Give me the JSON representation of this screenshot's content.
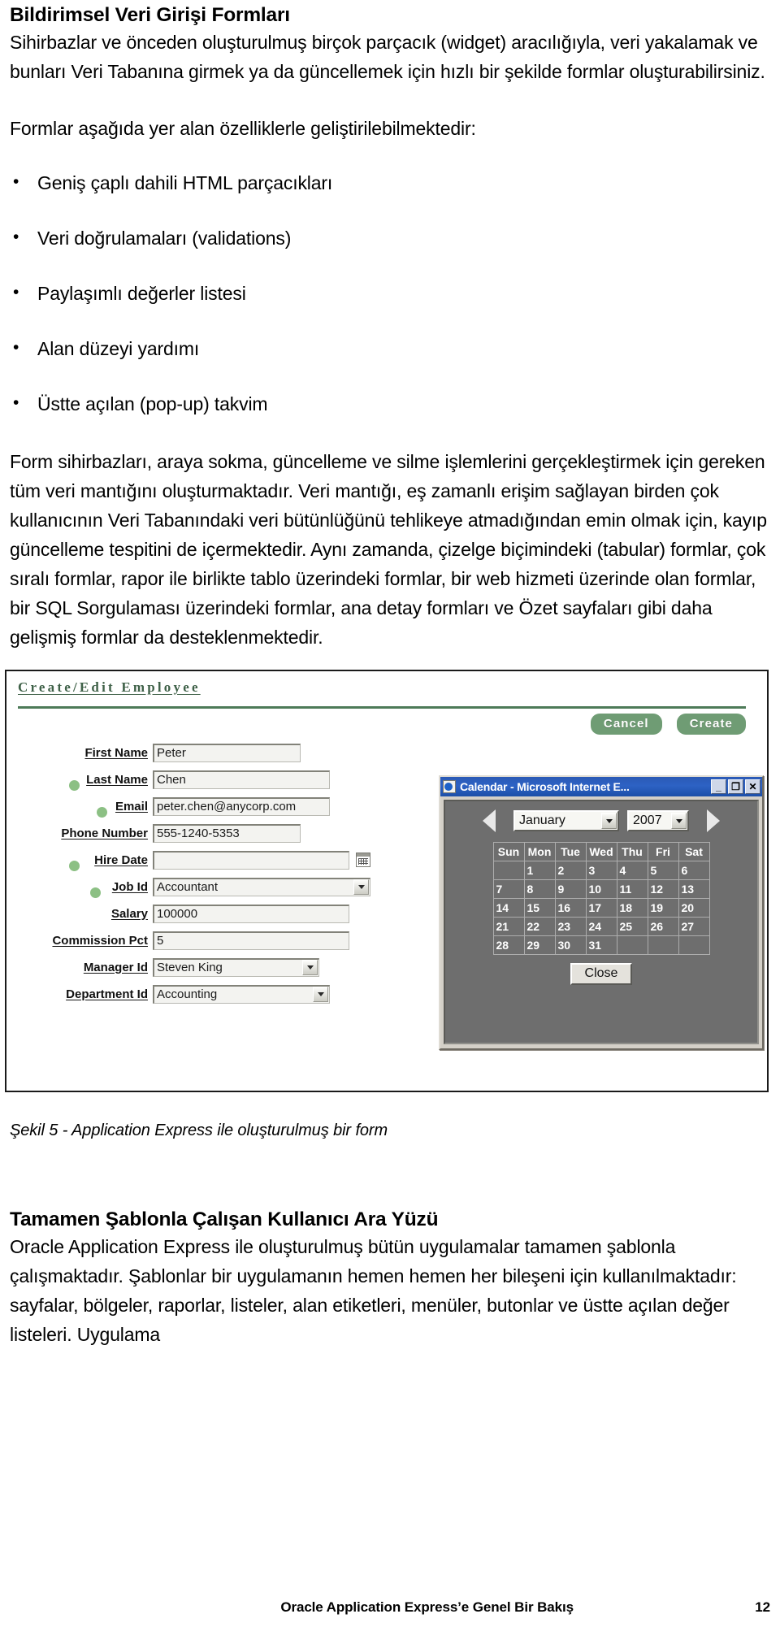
{
  "document": {
    "heading": "Bildirimsel Veri Girişi Formları",
    "intro_paragraph": "Sihirbazlar ve önceden oluşturulmuş birçok parçacık (widget) aracılığıyla, veri yakalamak ve bunları Veri Tabanına girmek ya da güncellemek için hızlı bir şekilde formlar oluşturabilirsiniz.",
    "lead_in": "Formlar aşağıda yer alan özelliklerle geliştirilebilmektedir:",
    "bullets": [
      "Geniş çaplı dahili HTML parçacıkları",
      "Veri doğrulamaları (validations)",
      " Paylaşımlı değerler listesi",
      "Alan düzeyi yardımı",
      "Üstte açılan (pop-up) takvim"
    ],
    "body_paragraph": "Form sihirbazları, araya sokma, güncelleme ve silme işlemlerini gerçekleştirmek için gereken tüm veri mantığını oluşturmaktadır.  Veri mantığı, eş zamanlı erişim sağlayan birden çok kullanıcının Veri Tabanındaki veri bütünlüğünü tehlikeye atmadığından emin olmak için, kayıp güncelleme tespitini de içermektedir.  Aynı zamanda, çizelge biçimindeki (tabular) formlar, çok sıralı formlar, rapor ile birlikte tablo üzerindeki formlar, bir web hizmeti üzerinde olan formlar, bir SQL Sorgulaması üzerindeki formlar, ana detay formları ve Özet sayfaları gibi daha gelişmiş formlar da desteklenmektedir.",
    "figure_caption": "Şekil 5 - Application Express ile oluşturulmuş bir form",
    "section2_heading": "Tamamen Şablonla Çalışan Kullanıcı Ara Yüzü",
    "section2_paragraph": "Oracle Application Express ile oluşturulmuş bütün uygulamalar tamamen şablonla çalışmaktadır.  Şablonlar bir uygulamanın hemen hemen her bileşeni için kullanılmaktadır:  sayfalar, bölgeler, raporlar, listeler, alan etiketleri, menüler, butonlar ve üstte açılan değer listeleri.  Uygulama"
  },
  "footer": {
    "title": "Oracle Application Express’e Genel Bir Bakış",
    "page_number": "12"
  },
  "figure": {
    "apex_form": {
      "region_title": "Create/Edit Employee",
      "buttons": [
        {
          "name": "cancel",
          "label": "Cancel"
        },
        {
          "name": "create",
          "label": "Create"
        }
      ],
      "accent_color": "#4d7a58",
      "button_color": "#6f9c74",
      "required_dot_color": "#8cc084",
      "fields": [
        {
          "label": "First Name",
          "value": "Peter",
          "type": "text",
          "required": false,
          "width": "w-first"
        },
        {
          "label": "Last Name",
          "value": "Chen",
          "type": "text",
          "required": true,
          "width": "w-last"
        },
        {
          "label": "Email",
          "value": "peter.chen@anycorp.com",
          "type": "text",
          "required": true,
          "width": "w-email"
        },
        {
          "label": "Phone Number",
          "value": "555-1240-5353",
          "type": "text",
          "required": false,
          "width": "w-phone"
        },
        {
          "label": "Hire Date",
          "value": "",
          "type": "date",
          "required": true,
          "width": "w-hire"
        },
        {
          "label": "Job Id",
          "value": "Accountant",
          "type": "select",
          "required": true,
          "width": "w-job"
        },
        {
          "label": "Salary",
          "value": "100000",
          "type": "text",
          "required": false,
          "width": "w-sal"
        },
        {
          "label": "Commission Pct",
          "value": "5",
          "type": "text",
          "required": false,
          "width": "w-comm"
        },
        {
          "label": "Manager Id",
          "value": "Steven King",
          "type": "select",
          "required": false,
          "width": "w-mgr"
        },
        {
          "label": "Department Id",
          "value": "Accounting",
          "type": "select",
          "required": false,
          "width": "w-dept"
        }
      ]
    },
    "calendar_window": {
      "title": "Calendar - Microsoft Internet E...",
      "window_buttons": [
        {
          "name": "minimize",
          "glyph": "_"
        },
        {
          "name": "maximize",
          "glyph": "❐"
        },
        {
          "name": "close",
          "glyph": "✕"
        }
      ],
      "month": "January",
      "year": "2007",
      "weekday_headers": [
        "Sun",
        "Mon",
        "Tue",
        "Wed",
        "Thu",
        "Fri",
        "Sat"
      ],
      "weeks": [
        [
          "",
          "1",
          "2",
          "3",
          "4",
          "5",
          "6"
        ],
        [
          "7",
          "8",
          "9",
          "10",
          "11",
          "12",
          "13"
        ],
        [
          "14",
          "15",
          "16",
          "17",
          "18",
          "19",
          "20"
        ],
        [
          "21",
          "22",
          "23",
          "24",
          "25",
          "26",
          "27"
        ],
        [
          "28",
          "29",
          "30",
          "31",
          "",
          "",
          ""
        ]
      ],
      "close_button_label": "Close",
      "background_color": "#6e6e6e",
      "titlebar_color": "#2d62c4"
    }
  }
}
